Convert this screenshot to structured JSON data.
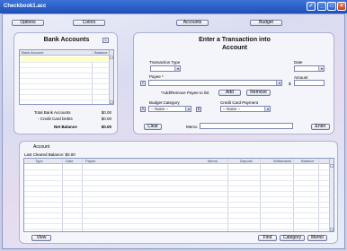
{
  "window": {
    "title": "Checkbook1.acc"
  },
  "toolbar": {
    "options": "Options",
    "colors": "Colors",
    "accounts": "Accounts",
    "budget": "Budget"
  },
  "bank": {
    "title": "Bank Accounts",
    "collapse": "«",
    "col_account": "Bank Account",
    "col_balance": "Balance",
    "total_label": "Total Bank Accounts",
    "total_value": "$0.00",
    "credit_label": "- Credit Card Debts",
    "credit_value": "$0.00",
    "net_label": "Net Balance",
    "net_value": "$0.00"
  },
  "txn": {
    "title_line1": "Enter a Transaction into",
    "title_line2": "Account",
    "type_label": "Transaction Type",
    "payee_label": "Payee *",
    "date_label": "Date",
    "amount_label": "Amount",
    "currency": "$",
    "add_remove_label": "*Add/Remove Payee to list",
    "add_button": "Add",
    "remove_button": "Remove",
    "budget_label": "Budget Category",
    "budget_value": "-- None --",
    "credit_label": "Credit Card Payment",
    "credit_value": "-- None --",
    "memo_label": "Memo",
    "clear_button": "Clear",
    "enter_button": "Enter",
    "plus": "+",
    "left_small": "<",
    "budget_btn": "A",
    "budget_btn2": "S"
  },
  "account": {
    "title": "Account",
    "cleared": "Last Cleared Balance: $0.00",
    "columns": [
      "Type",
      "Date",
      "Payee",
      "Memo",
      "Deposit",
      "Withdrawal",
      "Balance"
    ],
    "view_button": "View",
    "find_button": "Find",
    "category_button": "Category",
    "memo_button": "Memo"
  },
  "colors": {
    "title_bar": "#1f4fb7",
    "highlight_row": "#ffffc8"
  }
}
